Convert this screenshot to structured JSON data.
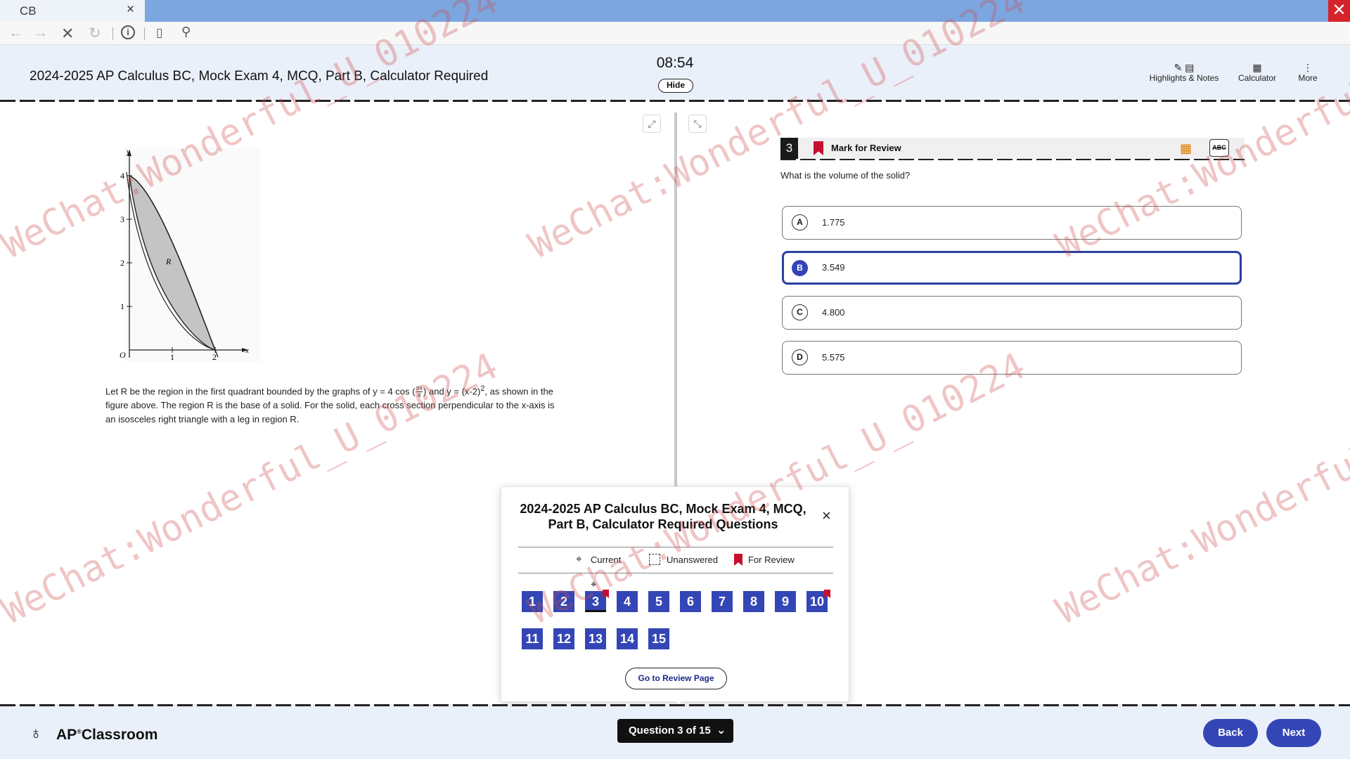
{
  "browser": {
    "tab_title": "CB",
    "tab_close": "×",
    "window_close": "✕",
    "nav_icons": [
      "back-icon",
      "forward-icon",
      "stop-icon",
      "refresh-icon",
      "info-icon",
      "page-icon",
      "search-icon"
    ]
  },
  "header": {
    "exam_title": "2024-2025 AP Calculus BC, Mock Exam 4, MCQ, Part B, Calculator Required",
    "timer": "08:54",
    "hide_label": "Hide",
    "tools": [
      {
        "label": "Highlights & Notes",
        "icon": "highlight-notes-icon"
      },
      {
        "label": "Calculator",
        "icon": "calculator-icon"
      },
      {
        "label": "More",
        "icon": "more-vertical-icon"
      }
    ]
  },
  "figure": {
    "y_axis_label": "y",
    "x_axis_label": "x",
    "origin_label": "O",
    "region_label": "R",
    "y_ticks": [
      "1",
      "2",
      "3",
      "4"
    ],
    "x_ticks": [
      "1",
      "2"
    ]
  },
  "passage": {
    "p1": "Let R be the region in the first quadrant bounded by the graphs of y = 4 cos",
    "frac_num": "πx",
    "frac_den": "4",
    "p2": "and y = (x-2)",
    "exp": "2",
    "p3": ", as shown in the figure above. The region R is the base of a solid. For the solid, each cross section perpendicular to the x-axis is an isosceles right triangle with a leg in region R."
  },
  "question": {
    "number": "3",
    "mark_label": "Mark for Review",
    "abc_label": "ABC",
    "stem": "What is the volume of the solid?",
    "choices": [
      {
        "letter": "A",
        "value": "1.775"
      },
      {
        "letter": "B",
        "value": "3.549"
      },
      {
        "letter": "C",
        "value": "4.800"
      },
      {
        "letter": "D",
        "value": "5.575"
      }
    ],
    "selected": "B"
  },
  "popup": {
    "title_line1": "2024-2025 AP Calculus BC, Mock Exam 4, MCQ,",
    "title_line2": "Part B, Calculator Required Questions",
    "close": "×",
    "legend_current": "Current",
    "legend_unanswered": "Unanswered",
    "legend_review": "For Review",
    "questions": [
      "1",
      "2",
      "3",
      "4",
      "5",
      "6",
      "7",
      "8",
      "9",
      "10",
      "11",
      "12",
      "13",
      "14",
      "15"
    ],
    "current": "3",
    "flagged": [
      "3",
      "10"
    ],
    "review_button": "Go to Review Page"
  },
  "footer": {
    "logo_text": "AP",
    "logo_sup": "®",
    "logo_text2": "Classroom",
    "question_pill": "Question 3 of 15",
    "back_label": "Back",
    "next_label": "Next"
  },
  "watermark": "WeChat:Wonderful_U_010224"
}
